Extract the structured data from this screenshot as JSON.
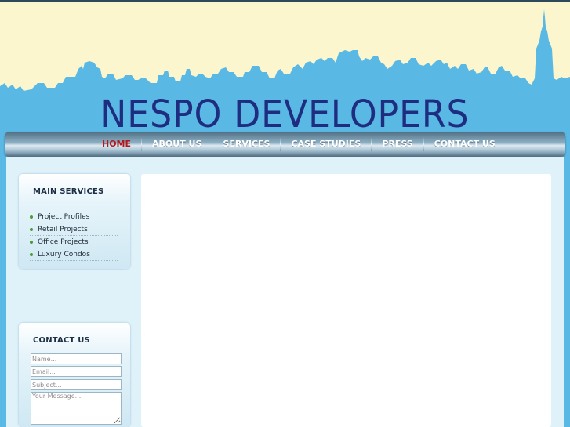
{
  "site": {
    "title": "NESPO DEVELOPERS"
  },
  "colors": {
    "header_bg": "#fbf6cd",
    "skyline": "#5ab8e4",
    "title": "#1f2d80",
    "active_nav": "#b4161c",
    "content_bg": "#dff1f9"
  },
  "nav": {
    "items": [
      {
        "label": "HOME",
        "active": true
      },
      {
        "label": "ABOUT US",
        "active": false
      },
      {
        "label": "SERVICES",
        "active": false
      },
      {
        "label": "CASE STUDIES",
        "active": false
      },
      {
        "label": "PRESS",
        "active": false
      },
      {
        "label": "CONTACT US",
        "active": false
      }
    ]
  },
  "sidebar": {
    "services": {
      "title": "MAIN SERVICES",
      "items": [
        {
          "label": "Project Profiles",
          "icon": "bullet-dot-icon"
        },
        {
          "label": "Retail Projects",
          "icon": "bullet-dot-icon"
        },
        {
          "label": "Office Projects",
          "icon": "bullet-dot-icon"
        },
        {
          "label": "Luxury Condos",
          "icon": "bullet-dot-icon"
        }
      ]
    },
    "contact": {
      "title": "CONTACT US",
      "name_placeholder": "Name...",
      "email_placeholder": "Email...",
      "subject_placeholder": "Subject...",
      "message_placeholder": "Your Message..."
    }
  }
}
